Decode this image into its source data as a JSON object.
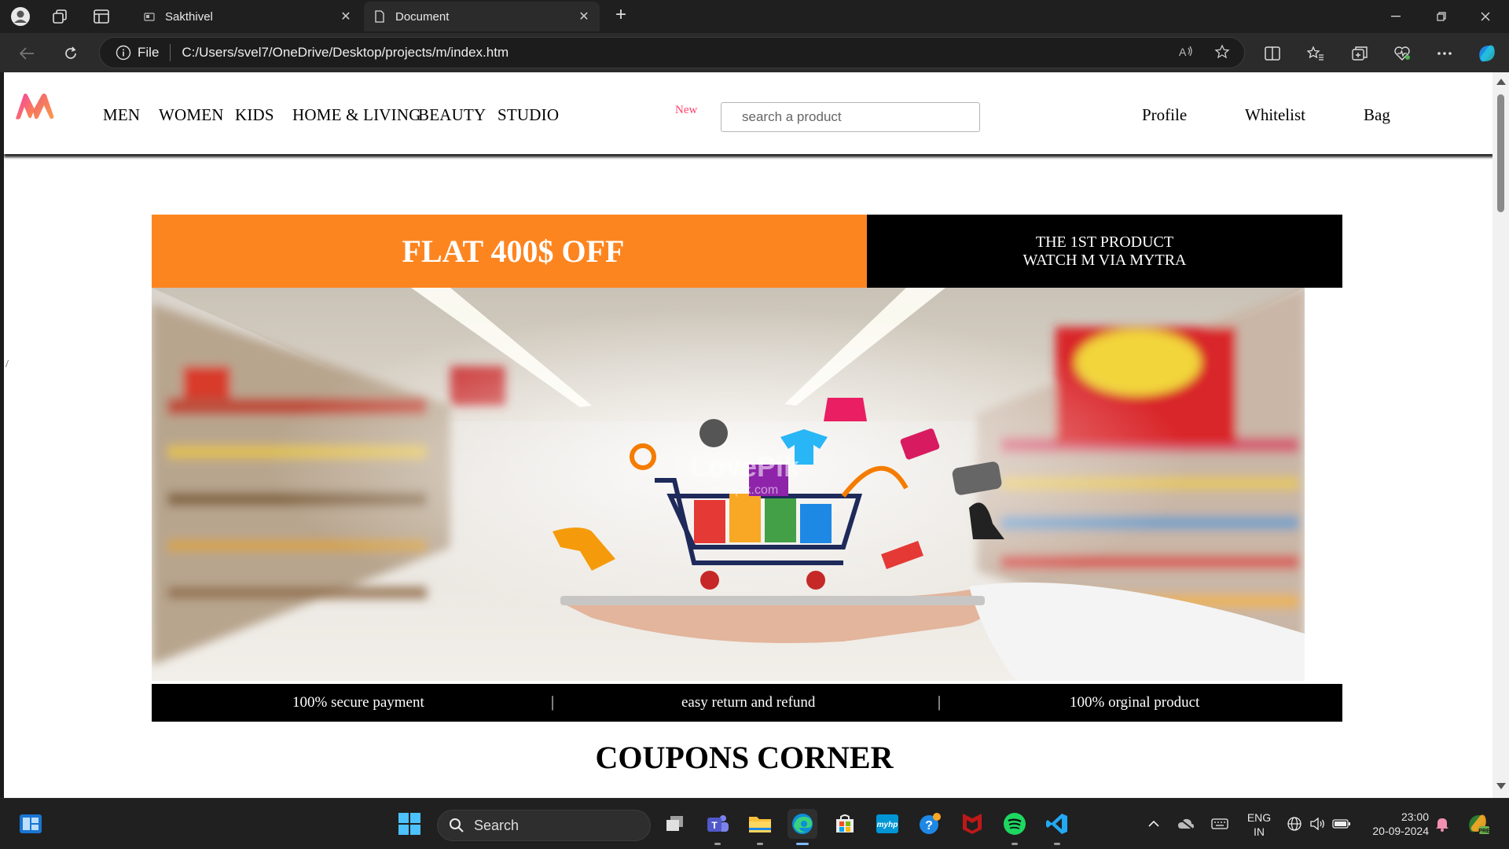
{
  "browser": {
    "tabs": [
      {
        "label": "Sakthivel",
        "close": "✕"
      },
      {
        "label": "Document",
        "close": "✕"
      }
    ],
    "new_tab": "+",
    "address": {
      "file_label": "File",
      "url": "C:/Users/svel7/OneDrive/Desktop/projects/m/index.htm"
    }
  },
  "page": {
    "nav": [
      "MEN",
      "WOMEN",
      "KIDS",
      "HOME & LIVING",
      "BEAUTY",
      "STUDIO"
    ],
    "nav_badge": "New",
    "search_placeholder": "search a product",
    "header_links": [
      "Profile",
      "Whitelist",
      "Bag"
    ],
    "promo_title": "FLAT 400$ OFF",
    "promo_side": "THE 1ST PRODUCT WATCH M VIA MYTRA",
    "hero_watermark": "LovePik",
    "hero_watermark_sub": "lovepik.com",
    "trust": [
      "100% secure payment",
      "|",
      "easy return and refund",
      "|",
      "100% orginal product"
    ],
    "coupons_heading": "COUPONS CORNER"
  },
  "taskbar": {
    "search_label": "Search",
    "lang_line1": "ENG",
    "lang_line2": "IN",
    "time": "23:00",
    "date": "20-09-2024"
  },
  "colors": {
    "promo_orange": "#fd8520",
    "brand_pink": "#ff3f6c",
    "trust_bar": "#000000"
  }
}
